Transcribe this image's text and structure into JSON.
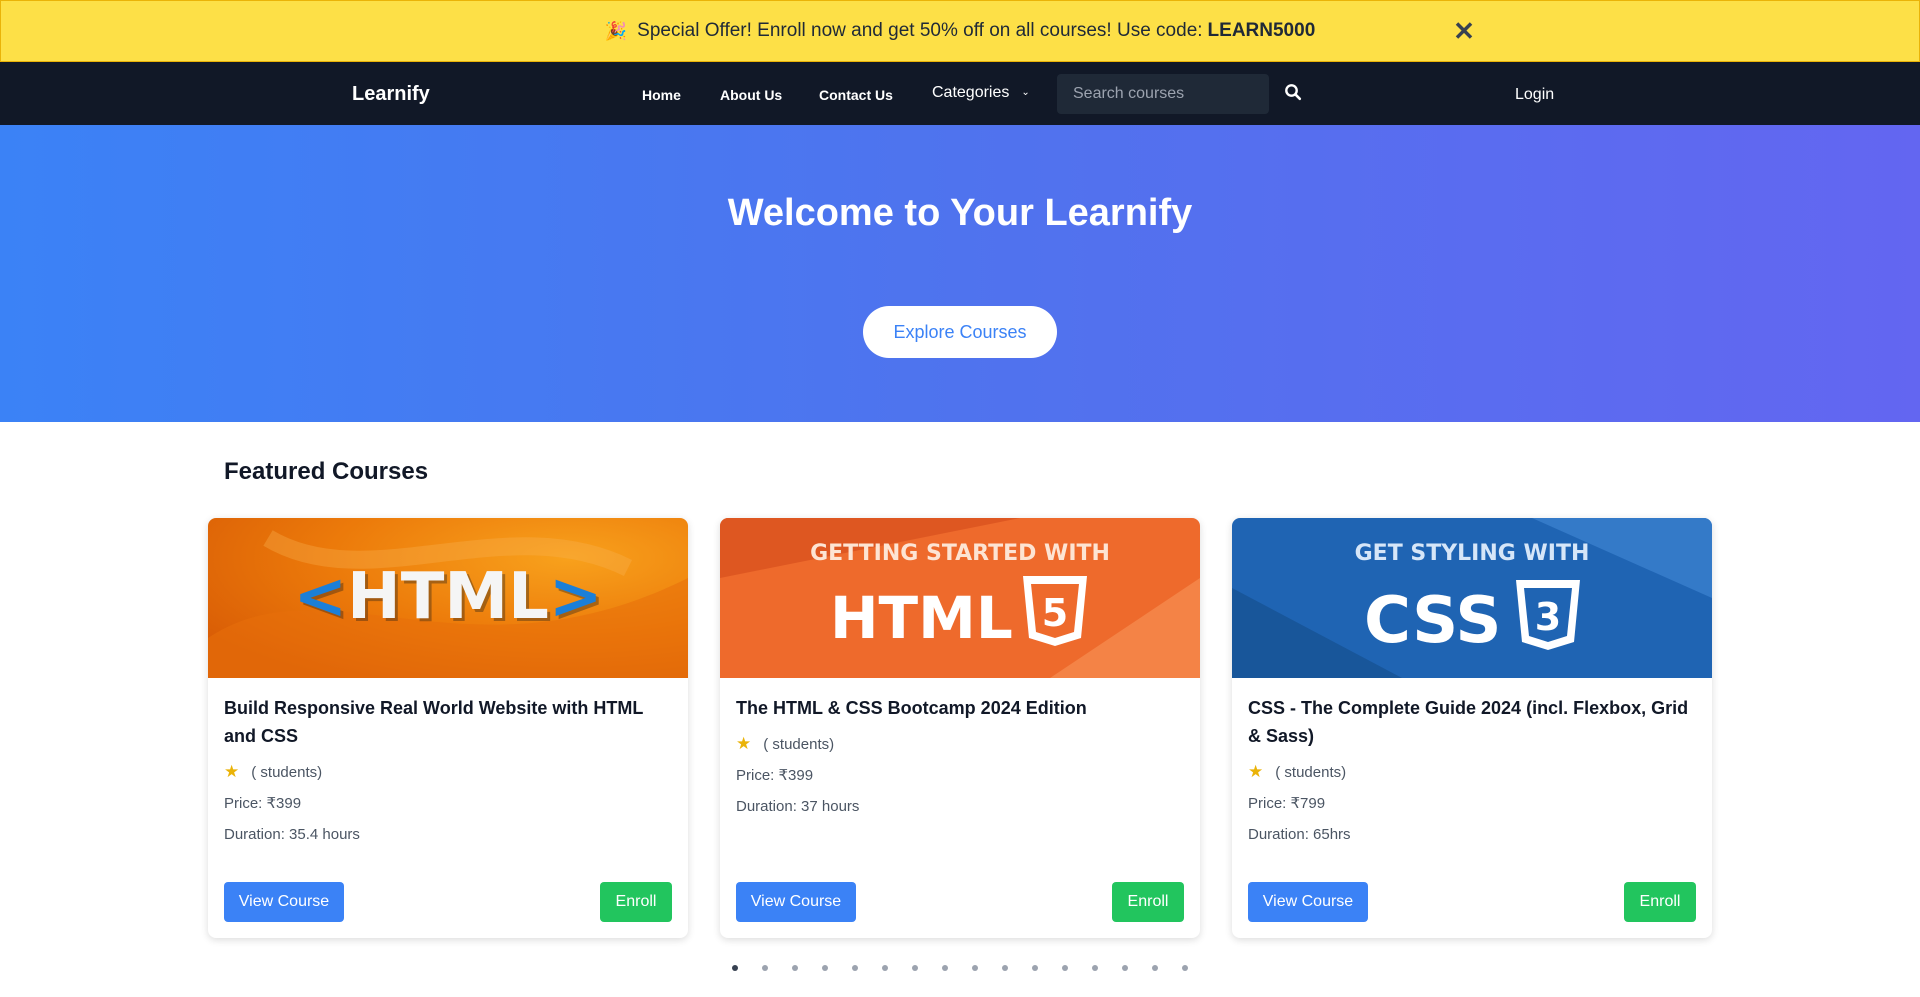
{
  "promo": {
    "icon": "party-popper-icon",
    "text": "Special Offer! Enroll now and get 50% off on all courses! Use code:",
    "code": "LEARN5000",
    "close_icon": "close-icon"
  },
  "nav": {
    "brand": "Learnify",
    "links": [
      "Home",
      "About Us",
      "Contact Us"
    ],
    "categories_label": "Categories",
    "search_placeholder": "Search courses",
    "search_icon": "search-icon",
    "login": "Login"
  },
  "hero": {
    "title": "Welcome to Your Learnify",
    "cta": "Explore Courses"
  },
  "featured": {
    "title": "Featured Courses",
    "courses": [
      {
        "image_text": "<HTML>",
        "title": "Build Responsive Real World Website with HTML and CSS",
        "rating_text": "( students)",
        "price": "Price: ₹399",
        "duration": "Duration: 35.4 hours",
        "view_label": "View Course",
        "enroll_label": "Enroll"
      },
      {
        "image_text_top": "GETTING STARTED WITH",
        "image_text_main": "HTML",
        "image_badge": "5",
        "title": "The HTML & CSS Bootcamp 2024 Edition",
        "rating_text": "( students)",
        "price": "Price: ₹399",
        "duration": "Duration: 37 hours",
        "view_label": "View Course",
        "enroll_label": "Enroll"
      },
      {
        "image_text_top": "GET STYLING WITH",
        "image_text_main": "CSS",
        "image_badge": "3",
        "title": "CSS - The Complete Guide 2024 (incl. Flexbox, Grid & Sass)",
        "rating_text": "( students)",
        "price": "Price: ₹799",
        "duration": "Duration: 65hrs",
        "view_label": "View Course",
        "enroll_label": "Enroll"
      }
    ]
  },
  "carousel": {
    "total_slides": 16,
    "active_index": 0
  },
  "colors": {
    "promo_bg": "#fde047",
    "nav_bg": "#111827",
    "hero_start": "#3b82f6",
    "hero_end": "#6366f1",
    "primary": "#3b82f6",
    "success": "#22c55e",
    "star": "#eab308"
  }
}
